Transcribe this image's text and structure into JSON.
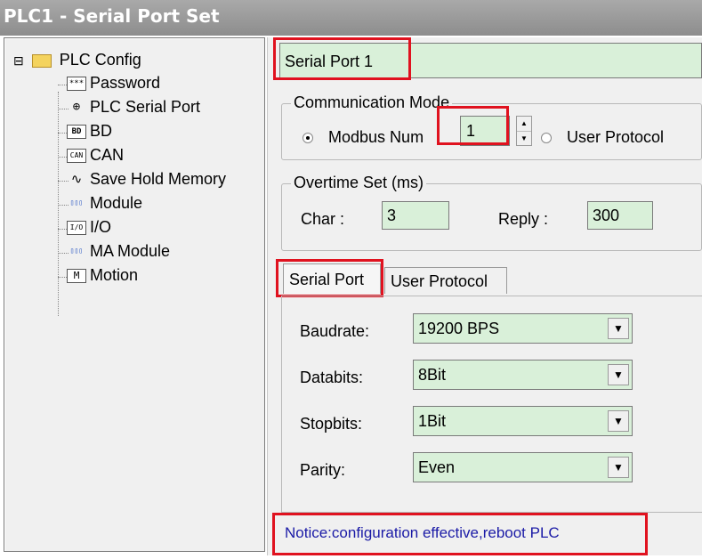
{
  "window": {
    "title": "PLC1 - Serial Port  Set"
  },
  "tree": {
    "root": {
      "label": "PLC Config",
      "icon": "folder-icon",
      "expander": "⊟"
    },
    "items": [
      {
        "label": "Password",
        "icon": "password-icon",
        "glyph": "***"
      },
      {
        "label": "PLC Serial Port",
        "icon": "serial-port-icon",
        "glyph": "⊕"
      },
      {
        "label": "BD",
        "icon": "bd-icon",
        "glyph": "BD"
      },
      {
        "label": "CAN",
        "icon": "can-icon",
        "glyph": "CAN"
      },
      {
        "label": "Save Hold Memory",
        "icon": "save-hold-memory-icon",
        "glyph": "∿"
      },
      {
        "label": "Module",
        "icon": "module-icon",
        "glyph": "▯▯▯"
      },
      {
        "label": "I/O",
        "icon": "io-icon",
        "glyph": "I/O"
      },
      {
        "label": "MA Module",
        "icon": "ma-module-icon",
        "glyph": "▯▯▯"
      },
      {
        "label": "Motion",
        "icon": "motion-icon",
        "glyph": "M"
      }
    ]
  },
  "port_selector": {
    "value": "Serial Port 1"
  },
  "communication_mode": {
    "legend": "Communication Mode",
    "modbus_label": "Modbus Num",
    "modbus_value": "1",
    "user_protocol_label": "User Protocol",
    "spin_up": "▲",
    "spin_down": "▼"
  },
  "overtime": {
    "legend": "Overtime Set (ms)",
    "char_label": "Char :",
    "char_value": "3",
    "reply_label": "Reply :",
    "reply_value": "300"
  },
  "tabs": [
    {
      "label": "Serial Port"
    },
    {
      "label": "User Protocol"
    }
  ],
  "serial_settings": {
    "baudrate_label": "Baudrate:",
    "baudrate_value": "19200 BPS",
    "databits_label": "Databits:",
    "databits_value": "8Bit",
    "stopbits_label": "Stopbits:",
    "stopbits_value": "1Bit",
    "parity_label": "Parity:",
    "parity_value": "Even",
    "dropdown_arrow": "▼"
  },
  "notice": "Notice:configuration effective,reboot PLC",
  "colors": {
    "highlight_box": "#e0121f",
    "input_bg": "#d9f0d9",
    "notice_text": "#1a1aa6"
  }
}
